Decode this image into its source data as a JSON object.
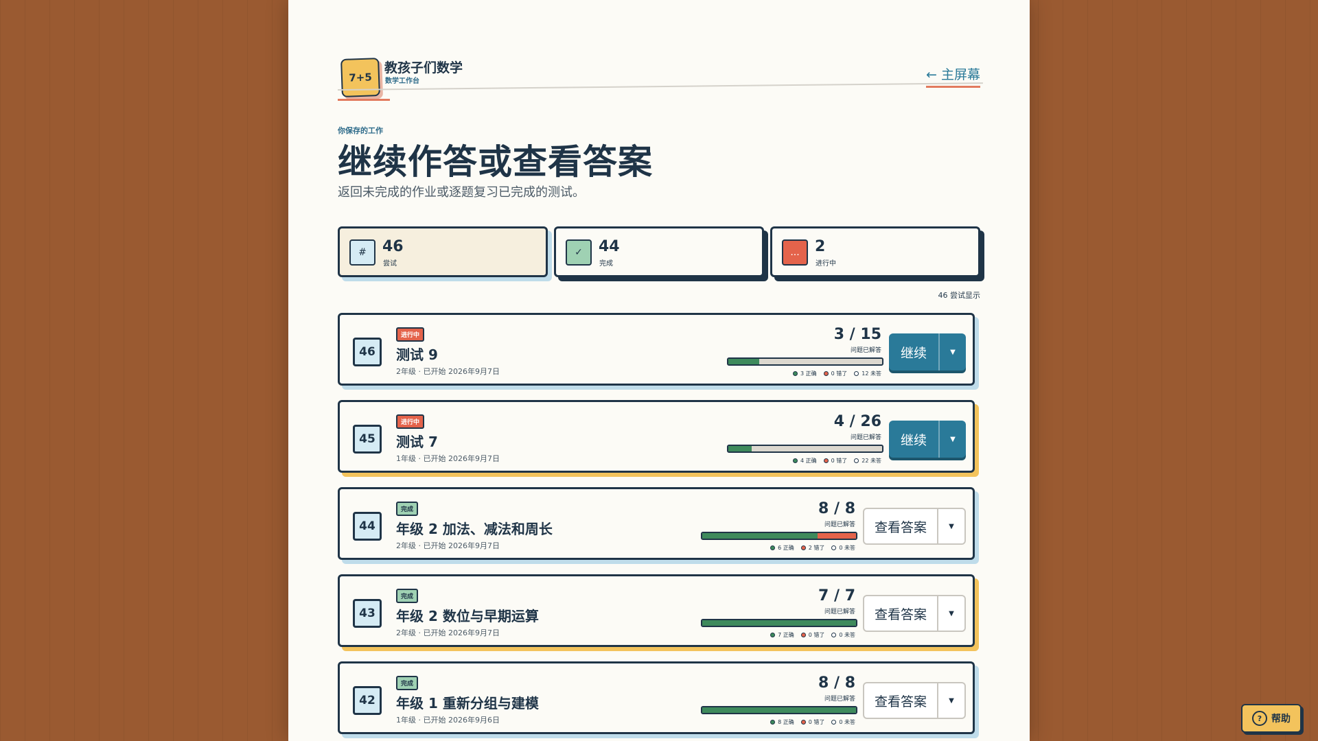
{
  "app": {
    "logo_text": "7+5",
    "title": "教孩子们数学",
    "subtitle": "数学工作台",
    "home_link": "← 主屏幕"
  },
  "header": {
    "eyebrow": "你保存的工作",
    "title": "继续作答或查看答案",
    "description": "返回未完成的作业或逐题复习已完成的测试。"
  },
  "stats": [
    {
      "icon": "#",
      "value": "46",
      "label": "尝试",
      "icon_color": "#d5ebf4"
    },
    {
      "icon": "✓",
      "value": "44",
      "label": "完成",
      "icon_color": "#9fd1b3"
    },
    {
      "icon": "...",
      "value": "2",
      "label": "进行中",
      "icon_color": "#e4634b"
    }
  ],
  "showing_text": "46 尝试显示",
  "attempts": [
    {
      "id": "46",
      "status": "进行中",
      "title": "测试 9",
      "meta": "2年级 · 已开始 2026年9月7日",
      "score": "3 / 15",
      "answered_label": "问题已解答",
      "correct": 3,
      "wrong": 0,
      "unanswered": 12,
      "total": 15,
      "legend_correct": "3 正确",
      "legend_wrong": "0 错了",
      "legend_unanswered": "12 未答",
      "button": "继续"
    },
    {
      "id": "45",
      "status": "进行中",
      "title": "测试 7",
      "meta": "1年级 · 已开始 2026年9月7日",
      "score": "4 / 26",
      "answered_label": "问题已解答",
      "correct": 4,
      "wrong": 0,
      "unanswered": 22,
      "total": 26,
      "legend_correct": "4 正确",
      "legend_wrong": "0 错了",
      "legend_unanswered": "22 未答",
      "button": "继续"
    },
    {
      "id": "44",
      "status": "完成",
      "title": "年级 2 加法、减法和周长",
      "meta": "2年级 · 已开始 2026年9月7日",
      "score": "8 / 8",
      "answered_label": "问题已解答",
      "correct": 6,
      "wrong": 2,
      "unanswered": 0,
      "total": 8,
      "legend_correct": "6 正确",
      "legend_wrong": "2 错了",
      "legend_unanswered": "0 未答",
      "button": "查看答案"
    },
    {
      "id": "43",
      "status": "完成",
      "title": "年级 2 数位与早期运算",
      "meta": "2年级 · 已开始 2026年9月7日",
      "score": "7 / 7",
      "answered_label": "问题已解答",
      "correct": 7,
      "wrong": 0,
      "unanswered": 0,
      "total": 7,
      "legend_correct": "7 正确",
      "legend_wrong": "0 错了",
      "legend_unanswered": "0 未答",
      "button": "查看答案"
    },
    {
      "id": "42",
      "status": "完成",
      "title": "年级 1 重新分组与建模",
      "meta": "1年级 · 已开始 2026年9月6日",
      "score": "8 / 8",
      "answered_label": "问题已解答",
      "correct": 8,
      "wrong": 0,
      "unanswered": 0,
      "total": 8,
      "legend_correct": "8 正确",
      "legend_wrong": "0 错了",
      "legend_unanswered": "0 未答",
      "button": "查看答案"
    }
  ],
  "help": {
    "label": "帮助",
    "icon": "?"
  },
  "colors": {
    "navy": "#1f3447",
    "teal": "#2a7a99",
    "green": "#3e8a5c",
    "red": "#e4634b",
    "yellow": "#f3c35c"
  }
}
